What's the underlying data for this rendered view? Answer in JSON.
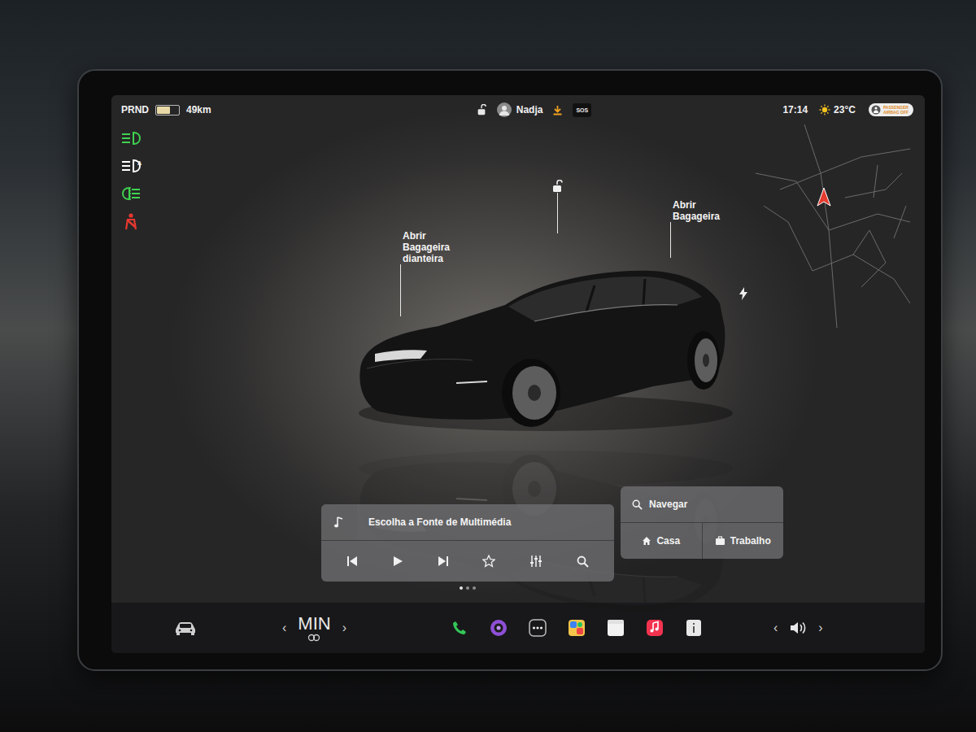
{
  "status_bar": {
    "gear": "PRND",
    "battery_level": 0.6,
    "range": "49km",
    "user": "Nadja",
    "sos": "SOS",
    "time": "17:14",
    "temperature": "23°C",
    "airbag_lines": [
      "PASSENGER",
      "AIRBAG OFF"
    ]
  },
  "indicators": [
    {
      "kind": "headlight",
      "color": "#3fd24f"
    },
    {
      "kind": "auto-headlight",
      "color": "#ffffff",
      "label": "A"
    },
    {
      "kind": "fog",
      "color": "#3fd24f"
    },
    {
      "kind": "seatbelt",
      "color": "#e8382f"
    }
  ],
  "callouts": [
    {
      "kind": "text",
      "lines": [
        "Abrir",
        "Bagageira",
        "dianteira"
      ]
    },
    {
      "kind": "lock"
    },
    {
      "kind": "text",
      "lines": [
        "Abrir",
        "Bagageira"
      ]
    },
    {
      "kind": "charge"
    }
  ],
  "media": {
    "title": "Escolha a Fonte de Multimédia"
  },
  "navigation": {
    "search": "Navegar",
    "home": "Casa",
    "work": "Trabalho"
  },
  "page_dots": [
    {
      "selected": true
    },
    {
      "selected": false
    },
    {
      "selected": false
    }
  ],
  "climate": {
    "left": "‹",
    "fan": "MIN",
    "right": "›"
  },
  "volume": {
    "left": "‹",
    "right": "›"
  }
}
